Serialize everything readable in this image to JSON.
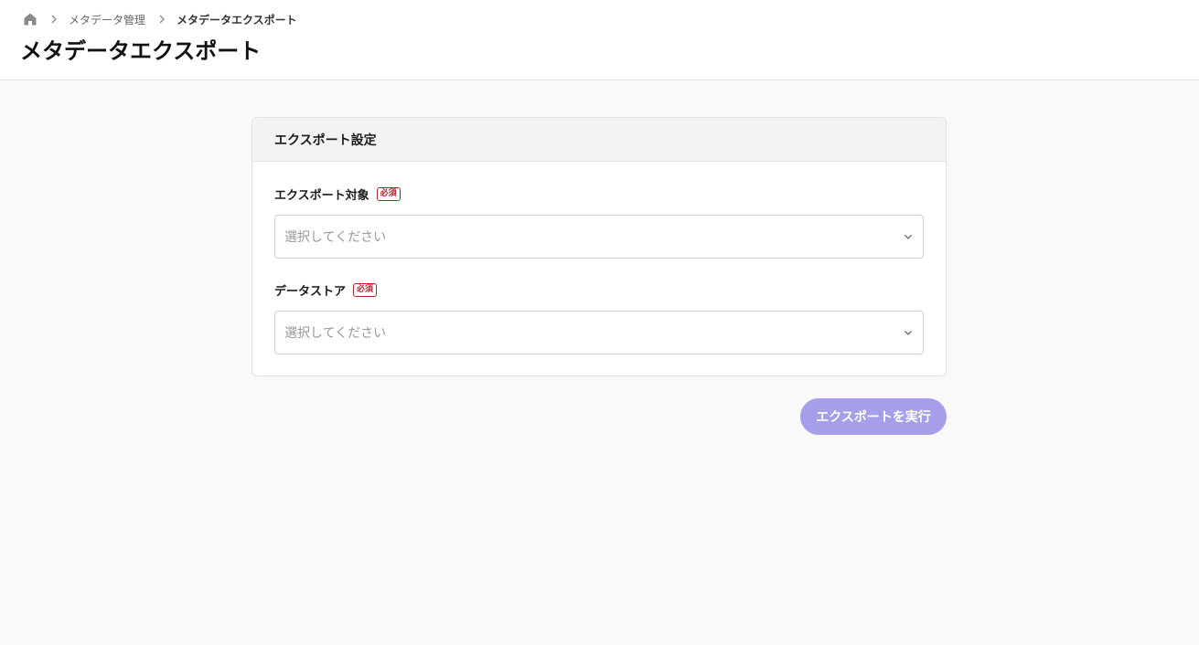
{
  "breadcrumb": {
    "home_icon": "home-icon",
    "items": [
      {
        "label": "メタデータ管理"
      },
      {
        "label": "メタデータエクスポート"
      }
    ]
  },
  "page": {
    "title": "メタデータエクスポート"
  },
  "card": {
    "title": "エクスポート設定",
    "fields": [
      {
        "label": "エクスポート対象",
        "required_badge": "必須",
        "placeholder": "選択してください"
      },
      {
        "label": "データストア",
        "required_badge": "必須",
        "placeholder": "選択してください"
      }
    ]
  },
  "actions": {
    "export_label": "エクスポートを実行"
  },
  "colors": {
    "primary_disabled": "#a59ee8",
    "required": "#b4232c"
  }
}
